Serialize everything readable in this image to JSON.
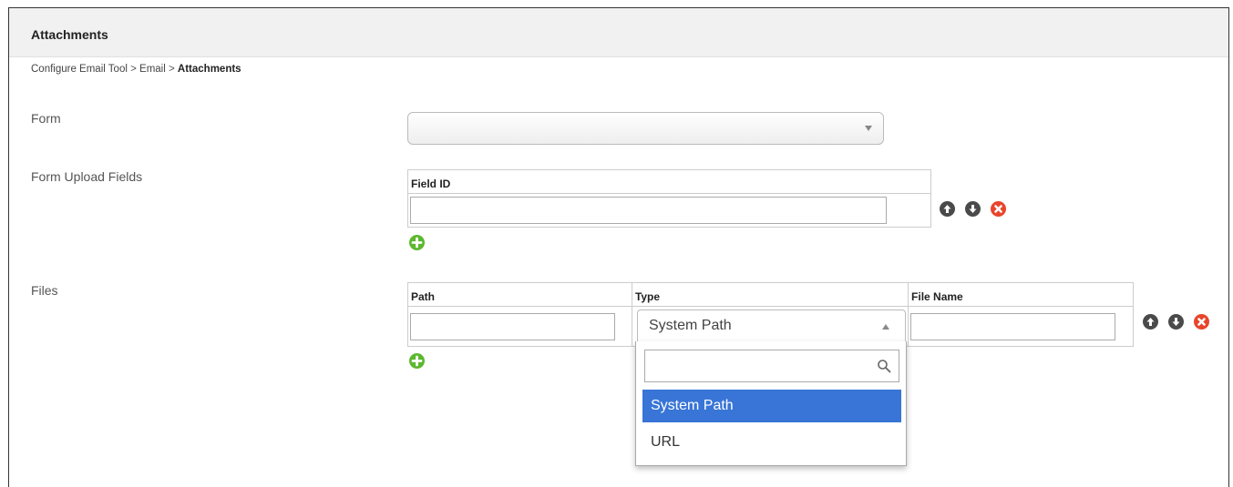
{
  "panel": {
    "title": "Attachments",
    "breadcrumb": {
      "items": [
        "Configure Email Tool",
        "Email",
        "Attachments"
      ],
      "separator": ">"
    }
  },
  "form": {
    "label": "Form",
    "select_value": ""
  },
  "upload_fields": {
    "label": "Form Upload Fields",
    "columns": [
      "Field ID"
    ],
    "rows": [
      {
        "field_id": ""
      }
    ]
  },
  "files": {
    "label": "Files",
    "columns": [
      "Path",
      "Type",
      "File Name"
    ],
    "rows": [
      {
        "path": "",
        "type": "System Path",
        "file_name": ""
      }
    ],
    "type_dropdown": {
      "open": true,
      "search_value": "",
      "options": [
        "System Path",
        "URL"
      ],
      "highlighted": "System Path"
    }
  },
  "icons": {
    "move_up": "arrow-up-circle-icon",
    "move_down": "arrow-down-circle-icon",
    "remove": "close-circle-icon",
    "add": "plus-circle-icon",
    "search": "search-icon"
  },
  "colors": {
    "header_bg": "#f1f1f1",
    "remove_red": "#e8452b",
    "add_green": "#5cb82e",
    "highlight_blue": "#3875d7"
  }
}
